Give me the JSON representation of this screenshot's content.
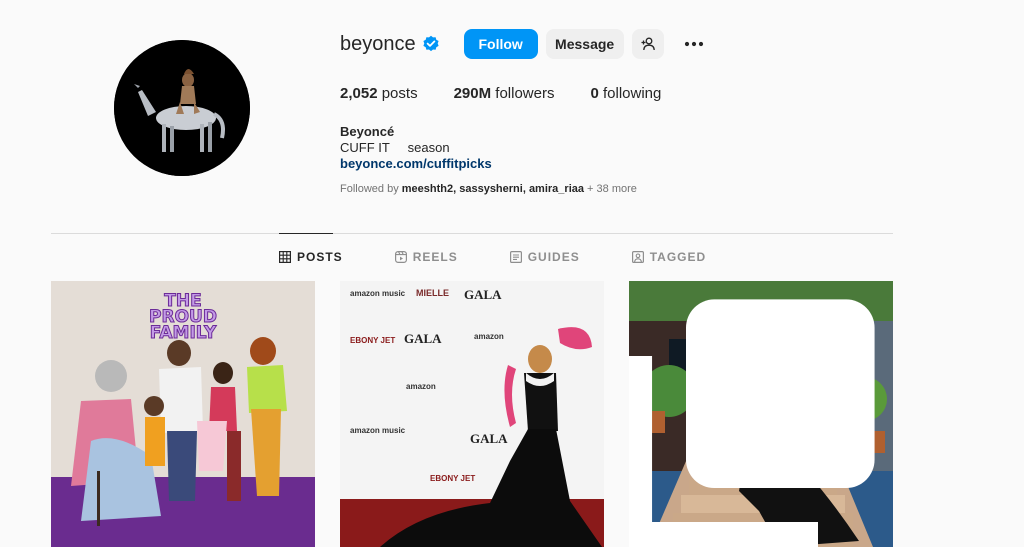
{
  "profile": {
    "username": "beyonce",
    "verified_icon": "verified-badge-icon",
    "follow_label": "Follow",
    "message_label": "Message",
    "add_user_icon": "add-user-icon",
    "more_icon": "more-options-icon",
    "accent_color": "#0095f6"
  },
  "stats": {
    "posts_count": "2,052",
    "posts_label": " posts",
    "followers_count": "290M",
    "followers_label": " followers",
    "following_count": "0",
    "following_label": " following"
  },
  "bio": {
    "full_name": "Beyoncé",
    "line": "CUFF IT     season",
    "link": "beyonce.com/cuffitpicks"
  },
  "followed_by": {
    "prefix": "Followed by ",
    "users": "meeshth2, sassysherni, amira_riaa",
    "more": " + 38 more"
  },
  "tabs": [
    {
      "label": "POSTS",
      "icon": "grid-icon"
    },
    {
      "label": "REELS",
      "icon": "reels-icon"
    },
    {
      "label": "GUIDES",
      "icon": "guides-icon"
    },
    {
      "label": "TAGGED",
      "icon": "tagged-icon"
    }
  ],
  "posts": {
    "p1_title_a": "THE",
    "p1_title_b": "PROUD",
    "p1_title_c": "FAMILY",
    "p2_backdrop_a": "amazon music",
    "p2_backdrop_b": "MIELLE",
    "p2_backdrop_c": "GALA",
    "p2_backdrop_d": "EBONY JET",
    "p2_backdrop_e": "amazon"
  }
}
